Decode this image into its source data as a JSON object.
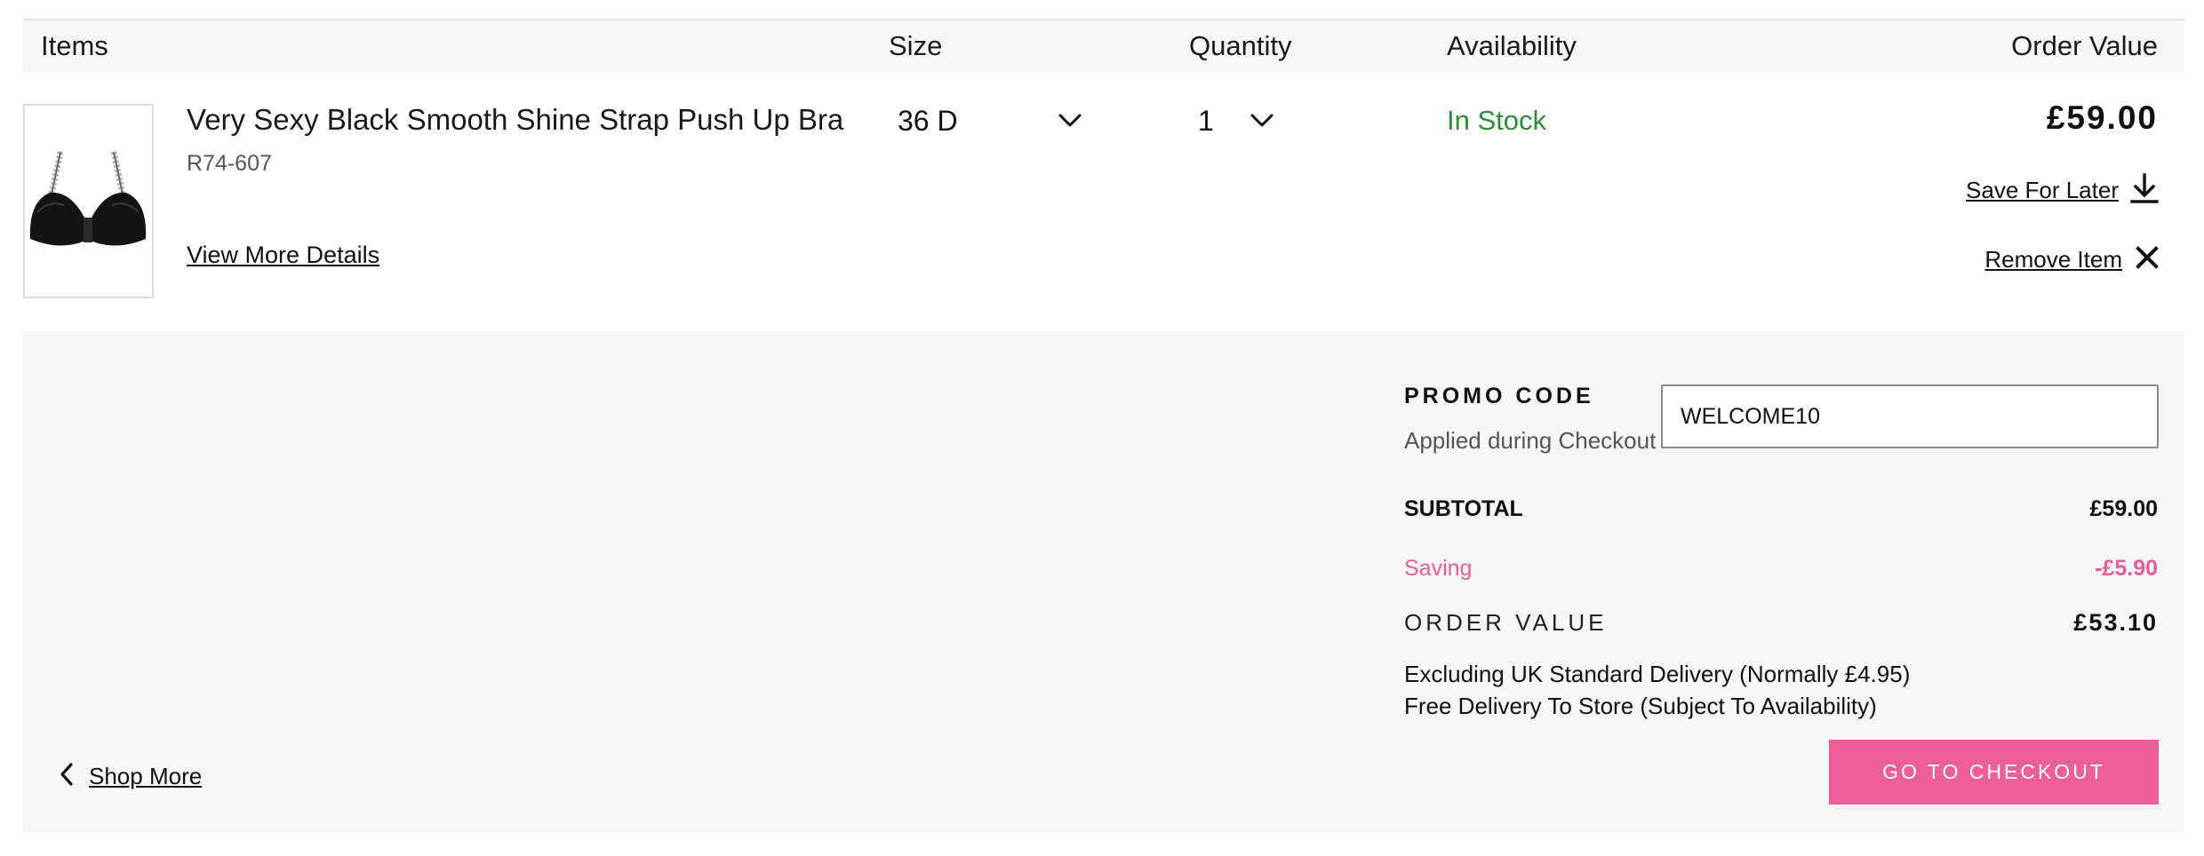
{
  "header": {
    "items": "Items",
    "size": "Size",
    "quantity": "Quantity",
    "availability": "Availability",
    "order_value": "Order Value"
  },
  "item": {
    "name": "Very Sexy Black Smooth Shine Strap Push Up Bra",
    "sku": "R74-607",
    "size": "36 D",
    "quantity": "1",
    "availability": "In Stock",
    "price": "£59.00",
    "save_for_later": "Save For Later",
    "remove": "Remove Item",
    "view_details": "View More Details",
    "availability_color": "#2f8a3a"
  },
  "promo": {
    "title": "PROMO CODE",
    "subtitle": "Applied during Checkout",
    "code": "WELCOME10"
  },
  "summary": {
    "subtotal_label": "SUBTOTAL",
    "subtotal_value": "£59.00",
    "saving_label": "Saving",
    "saving_value": "-£5.90",
    "order_value_label": "ORDER VALUE",
    "order_value": "£53.10",
    "delivery_note_1": "Excluding UK Standard Delivery (Normally £4.95)",
    "delivery_note_2": "Free Delivery To Store (Subject To Availability)",
    "saving_color": "#e35d9a"
  },
  "actions": {
    "shop_more": "Shop More",
    "checkout": "GO TO CHECKOUT",
    "checkout_color": "#ef5f97"
  },
  "icons": {
    "size_dropdown": "chevron-down-icon",
    "quantity_dropdown": "chevron-down-icon",
    "save_for_later": "download-icon",
    "remove_item": "close-icon",
    "shop_more": "chevron-left-icon"
  }
}
